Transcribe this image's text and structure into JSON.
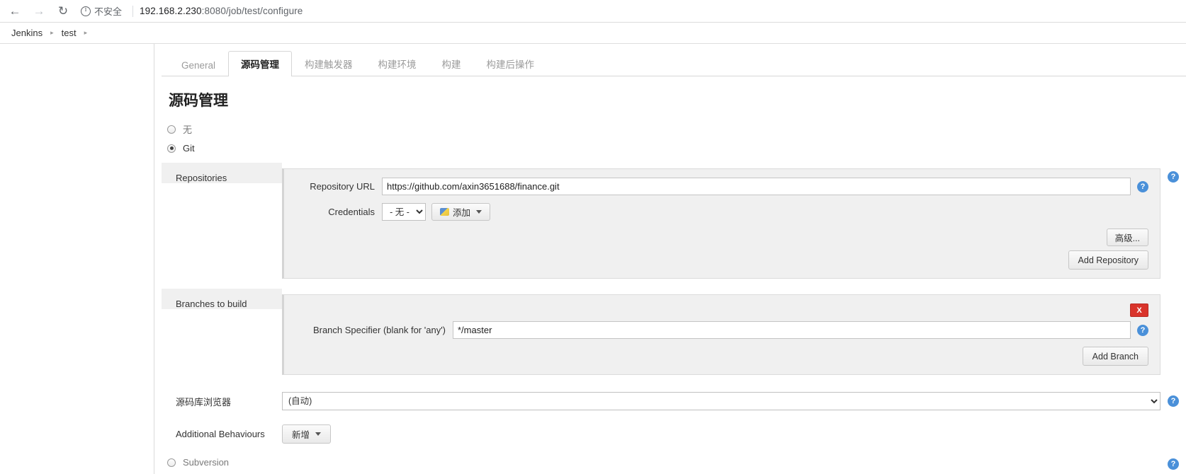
{
  "browser": {
    "back_icon": "arrow-left",
    "forward_icon": "arrow-right",
    "reload_icon": "reload",
    "security_label": "不安全",
    "url_host": "192.168.2.230",
    "url_rest": ":8080/job/test/configure"
  },
  "breadcrumb": {
    "items": [
      "Jenkins",
      "test"
    ],
    "separator": "▸"
  },
  "tabs": [
    {
      "label": "General",
      "active": false
    },
    {
      "label": "源码管理",
      "active": true
    },
    {
      "label": "构建触发器",
      "active": false
    },
    {
      "label": "构建环境",
      "active": false
    },
    {
      "label": "构建",
      "active": false
    },
    {
      "label": "构建后操作",
      "active": false
    }
  ],
  "page": {
    "title": "源码管理"
  },
  "scm_options": [
    {
      "label": "无",
      "checked": false
    },
    {
      "label": "Git",
      "checked": true
    },
    {
      "label": "Subversion",
      "checked": false
    }
  ],
  "repositories": {
    "label": "Repositories",
    "url_field": {
      "label": "Repository URL",
      "value": "https://github.com/axin3651688/finance.git"
    },
    "credentials": {
      "label": "Credentials",
      "selected": "- 无 -",
      "options": [
        "- 无 -"
      ],
      "add_button": "添加"
    },
    "advanced_button": "高级...",
    "add_repository_button": "Add Repository"
  },
  "branches": {
    "label": "Branches to build",
    "delete_button": "X",
    "specifier": {
      "label": "Branch Specifier (blank for 'any')",
      "value": "*/master"
    },
    "add_branch_button": "Add Branch"
  },
  "browser_picker": {
    "label": "源码库浏览器",
    "selected": "(自动)",
    "options": [
      "(自动)"
    ]
  },
  "additional_behaviours": {
    "label": "Additional Behaviours",
    "add_button": "新增"
  },
  "help": {
    "glyph": "?"
  },
  "colors": {
    "accent": "#4a90d9",
    "danger": "#d9342b",
    "panel_bg": "#f0f0f0"
  }
}
